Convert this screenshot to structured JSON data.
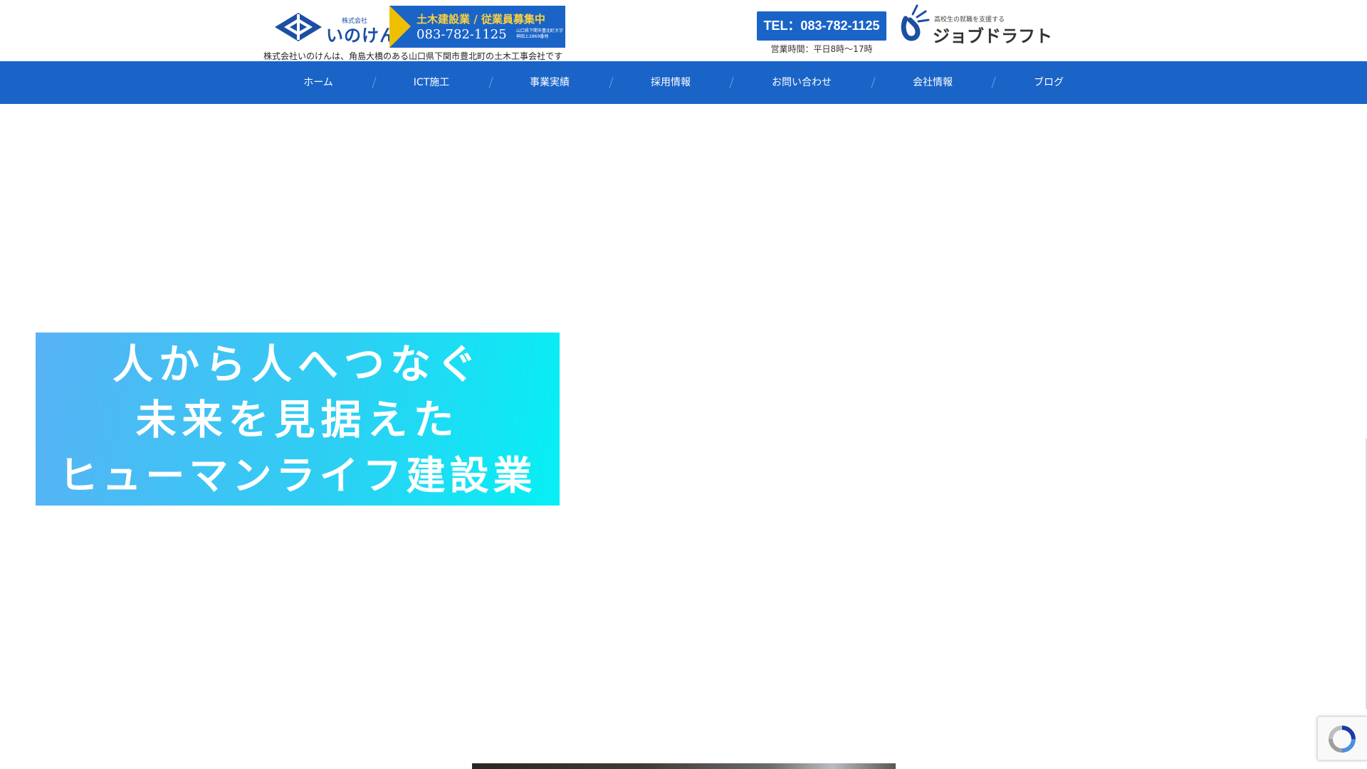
{
  "header": {
    "logo": {
      "small_text": "株式会社",
      "name": "いのけん"
    },
    "recruit_banner": {
      "title": "土木建設業 / 従業員募集中",
      "phone": "083-782-1125",
      "address": "山口県下関市豊北町大字神田上2869番地"
    },
    "tagline": "株式会社いのけんは、角島大橋のある山口県下関市豊北町の土木工事会社です",
    "tel_button": "TEL：083-782-1125",
    "business_hours": "営業時間：平日8時～17時",
    "jobdraft": {
      "small_text": "高校生の就職を支援する",
      "name": "ジョブドラフト"
    }
  },
  "nav": {
    "items": [
      {
        "label": "ホーム"
      },
      {
        "label": "ICT施工"
      },
      {
        "label": "事業実績"
      },
      {
        "label": "採用情報"
      },
      {
        "label": "お問い合わせ"
      },
      {
        "label": "会社情報"
      },
      {
        "label": "ブログ"
      }
    ]
  },
  "hero": {
    "lines": [
      "人から人へつなぐ",
      "未来を見据えた",
      "ヒューマンライフ建設業"
    ]
  },
  "colors": {
    "brand_blue": "#1a64c8",
    "banner_yellow": "#f0c000",
    "hero_gradient_start": "#58b2f5",
    "hero_gradient_end": "#06f0f4"
  },
  "icons": {
    "logo": "inoken-diamond-logo-icon",
    "jobdraft": "jobdraft-logo-icon",
    "recaptcha": "recaptcha-icon"
  }
}
